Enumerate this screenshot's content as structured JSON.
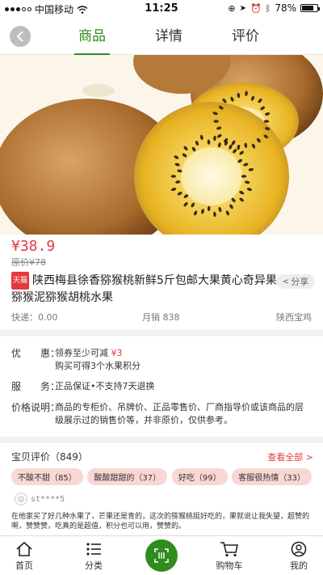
{
  "status_bar": {
    "carrier": "中国移动",
    "time": "11:25",
    "battery": "78%",
    "battery_level": 0.78
  },
  "nav": {
    "tabs": [
      "商品",
      "详情",
      "评价"
    ],
    "active_tab": 0
  },
  "product": {
    "price": "¥38.9",
    "original_price": "原价¥78",
    "tag": "天猫",
    "title": "陕西梅县徐香猕猴桃新鲜5斤包邮大果黄心奇异果猕猴泥猕猴胡桃水果",
    "share_label": "分享",
    "shipping": "快递：0.00",
    "monthly_sales": "月销 838",
    "location": "陕西宝鸡"
  },
  "info": {
    "promo_label": "优　　惠：",
    "promo_text_a": "领券至少可减",
    "promo_amount": "¥3",
    "promo_text_b": "购买可得3个水果积分",
    "service_label": "服　　务：",
    "service_text": "正品保证•不支持7天退换",
    "price_note_label": "价格说明：",
    "price_note_text": "商品的专柜价、吊牌价、正品零售价、厂商指导价或该商品的层级展示过的销售价等，并非原价，仅供参考。"
  },
  "reviews": {
    "header": "宝贝评价（849）",
    "view_all": "查看全部 >",
    "tags": [
      "不酸不甜（85）",
      "酸酸甜甜的（37）",
      "好吃（99）",
      "客服很热情（33）"
    ],
    "user": "st****5",
    "text": "在他家买了好几种水果了，芒果还是青的，这次的猕猴桃挺好吃的，果就说让我失望，超赞的啊，赞赞赞，吃真的是超值，积分也可以用，赞赞的。"
  },
  "bottom_bar": {
    "home": "首页",
    "category": "分类",
    "cart": "购物车",
    "mine": "我的"
  },
  "colors": {
    "accent_green": "#2f8c1d",
    "price_red": "#e4393c",
    "chip_bg": "#f8d7d5"
  }
}
